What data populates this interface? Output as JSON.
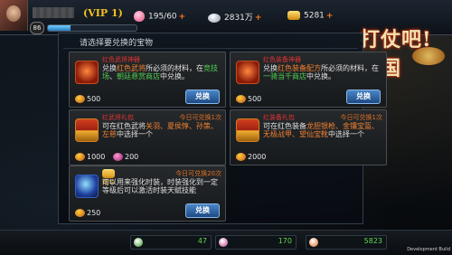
{
  "header": {
    "level": "86",
    "vip": "(VIP 1)",
    "stamina": "195/60",
    "silver": "2831万",
    "gold": "5281",
    "plus": "+"
  },
  "logo_text": "打仗吧!三国",
  "panel_title": "请选择要兑换的宝物",
  "cards": [
    {
      "title": "红色武将神器",
      "limit": "",
      "desc_pre": "兑换",
      "desc_hl1": "红色武将",
      "desc_mid": "所必须的材料，在",
      "desc_hl2": "竞技场",
      "desc_sep": "、",
      "desc_hl3": "朝廷悬赏商店",
      "desc_post": "中兑换。",
      "cost1": "500",
      "cost2": "",
      "button": "兑换"
    },
    {
      "title": "红色装备神器",
      "limit": "",
      "desc_pre": "兑换",
      "desc_hl1": "红色装备配方",
      "desc_mid": "所必须的材料，在",
      "desc_hl2": "一骑当千商店",
      "desc_sep": "",
      "desc_hl3": "",
      "desc_post": "中兑换。",
      "cost1": "500",
      "cost2": "",
      "button": "兑换"
    },
    {
      "title": "红武将礼包",
      "limit": "今日可兑换1次",
      "desc_pre": "可在红色武将",
      "desc_hl1": "关羽、夏侯惇、孙策、左慈",
      "desc_mid": "中选择一个",
      "desc_hl2": "",
      "desc_sep": "",
      "desc_hl3": "",
      "desc_post": "",
      "cost1": "1000",
      "cost2": "200",
      "button": "兑换"
    },
    {
      "title": "红装备礼包",
      "limit": "今日可兑换1次",
      "desc_pre": "可在红色装备",
      "desc_hl1": "龙胆银枪、金镶宝盔、无极战甲、望仙宝靴",
      "desc_mid": "中选择一个",
      "desc_hl2": "",
      "desc_sep": "",
      "desc_hl3": "",
      "desc_post": "",
      "cost1": "2000",
      "cost2": "",
      "button": "兑换"
    },
    {
      "title": "时装精华",
      "limit": "今日可兑换20次",
      "desc_pre": "可以用来强化时装，时装强化到一定等级后可以激活时装天赋技能",
      "desc_hl1": "",
      "desc_mid": "",
      "desc_hl2": "",
      "desc_sep": "",
      "desc_hl3": "",
      "desc_post": "",
      "cost1": "250",
      "cost2": "",
      "button": "兑换"
    }
  ],
  "bottom": [
    {
      "value": "47",
      "color": "#3a9a2a"
    },
    {
      "value": "170",
      "color": "#c03a8a"
    },
    {
      "value": "5823",
      "color": "#e06a20"
    }
  ],
  "build_label": "Development Build",
  "exp_progress": 0.25
}
